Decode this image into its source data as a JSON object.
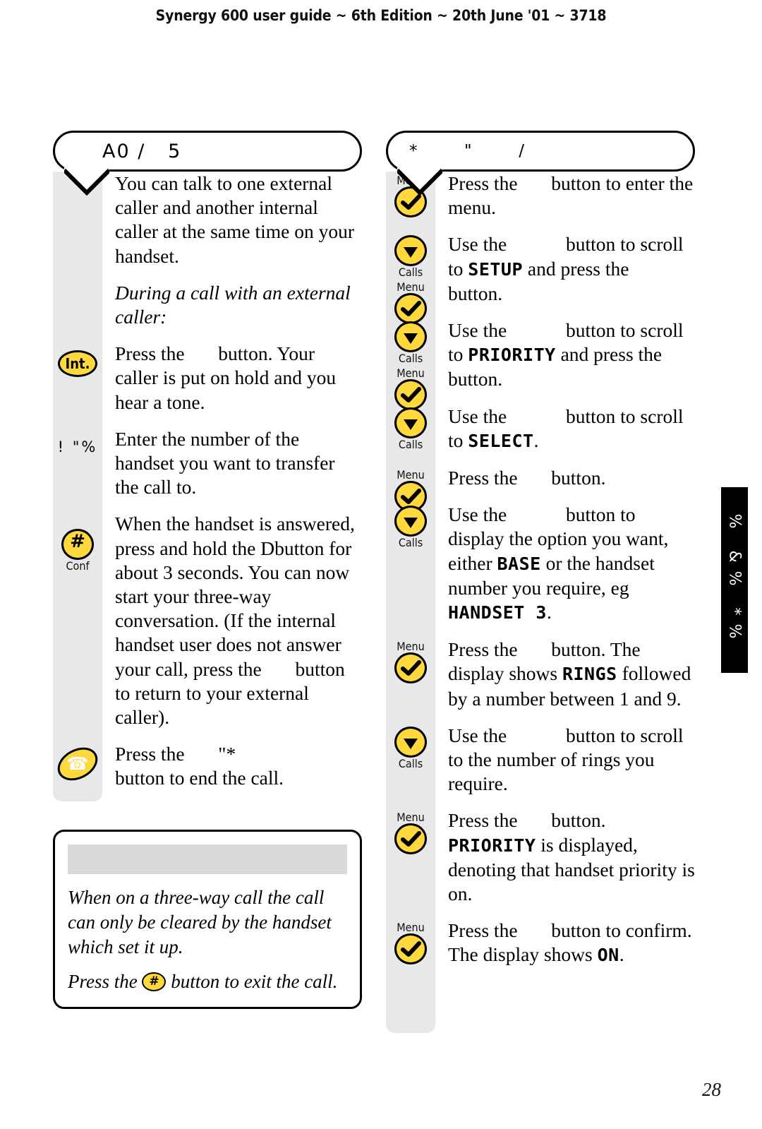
{
  "header": {
    "running_head": "Synergy 600 user guide ~ 6th Edition ~ 20th June '01 ~ 3718"
  },
  "page_number": "28",
  "thumb_tab": {
    "label": "%  &%  *%"
  },
  "left_column": {
    "callout_title": "A0 /   5",
    "steps": [
      {
        "icon": null,
        "text_html": "You can talk to one external caller and another internal caller at the same time on your handset."
      },
      {
        "icon": null,
        "italic": true,
        "text_html": "During a call with an external caller:"
      },
      {
        "icon": "int-key",
        "icon_label": "Int.",
        "text_html": "Press the <span class=\"gap\"></span> button. Your caller is put on hold and you hear a tone."
      },
      {
        "icon": "glyph-artifact",
        "icon_label": "! \"%",
        "text_html": "Enter the number of the handset you want to transfer the call to."
      },
      {
        "icon": "conf-key",
        "icon_label": "Conf",
        "text_html": "When the handset is answered, press and hold the Dbutton for about 3 seconds. You can now start your three-way conversation. (If the internal handset user does not answer your call, press the <span class=\"gap\"></span> button to return to your external caller)."
      },
      {
        "icon": "phone-key",
        "icon_label": "",
        "text_html": "Press the <span class=\"gap\"></span> \"* <br>button to end the call."
      }
    ]
  },
  "note_box": {
    "heading": "",
    "paragraphs": [
      "When on a three-way call the call can only be cleared by the handset which set it up.",
      "Press the <span class=\"inline-key\"><span>#</span></span> button to exit the call."
    ]
  },
  "right_column": {
    "callout_title": "*     \"     /",
    "steps": [
      {
        "icons": [
          {
            "type": "check",
            "label_above": "Menu",
            "label_below": ""
          }
        ],
        "text_html": "Press the <span class=\"gap\"></span> button to enter the menu."
      },
      {
        "icons": [
          {
            "type": "down",
            "label_above": "",
            "label_below": "Calls"
          },
          {
            "type": "check",
            "label_above": "Menu",
            "label_below": ""
          }
        ],
        "text_html": "Use the <span class=\"gap-wide\"></span> button to scroll to <span class=\"lcd\">SETUP</span> and press the <span class=\"gap-sm\"></span> button."
      },
      {
        "icons": [
          {
            "type": "down",
            "label_above": "",
            "label_below": "Calls"
          },
          {
            "type": "check",
            "label_above": "Menu",
            "label_below": ""
          }
        ],
        "text_html": "Use the <span class=\"gap-wide\"></span> button to scroll to <span class=\"lcd\">PRIORITY</span> and press the <span class=\"gap\"></span> button."
      },
      {
        "icons": [
          {
            "type": "down",
            "label_above": "",
            "label_below": "Calls"
          }
        ],
        "text_html": "Use the <span class=\"gap-wide\"></span> button to scroll to <span class=\"lcd\">SELECT</span>."
      },
      {
        "icons": [
          {
            "type": "check",
            "label_above": "Menu",
            "label_below": ""
          }
        ],
        "text_html": "Press the <span class=\"gap\"></span> button."
      },
      {
        "icons": [
          {
            "type": "down",
            "label_above": "",
            "label_below": "Calls"
          }
        ],
        "text_html": "Use the <span class=\"gap-wide\"></span> button to display the option you want, either <span class=\"lcd\">BASE</span> or the handset number you require, eg <span class=\"lcd\">HANDSET 3</span>."
      },
      {
        "icons": [
          {
            "type": "check",
            "label_above": "Menu",
            "label_below": ""
          }
        ],
        "text_html": "Press the <span class=\"gap\"></span> button. The display shows <span class=\"lcd\">RINGS</span> followed by a number between 1 and 9."
      },
      {
        "icons": [
          {
            "type": "down",
            "label_above": "",
            "label_below": "Calls"
          }
        ],
        "text_html": "Use the <span class=\"gap-wide\"></span> button to scroll to the number of rings you require."
      },
      {
        "icons": [
          {
            "type": "check",
            "label_above": "Menu",
            "label_below": ""
          }
        ],
        "text_html": "Press the <span class=\"gap\"></span> button. <span class=\"lcd\">PRIORITY</span> is displayed, denoting that handset priority is on."
      },
      {
        "icons": [
          {
            "type": "check",
            "label_above": "Menu",
            "label_below": ""
          }
        ],
        "text_html": "Press the <span class=\"gap\"></span> button to confirm. The display shows <span class=\"lcd\">ON</span>."
      }
    ]
  },
  "colors": {
    "key_yellow": "#ffd83d",
    "gutter_gray": "#e8e8e8",
    "note_bar_gray": "#d9d9d9",
    "tab_black": "#000000"
  }
}
